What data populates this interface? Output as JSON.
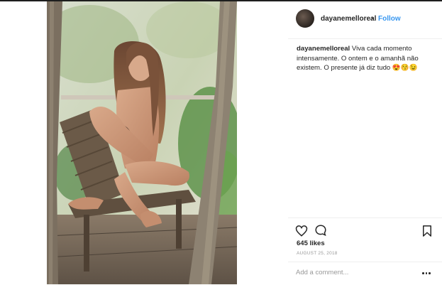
{
  "post": {
    "username": "dayanemelloreal",
    "separator": "•",
    "follow_label": "Follow",
    "caption_text": "Viva cada momento intensamente. O ontem e o amanhã não existem. O presente já diz tudo",
    "caption_emojis": "😍😚😉",
    "likes": "645 likes",
    "date": "AUGUST 25, 2018",
    "comment_placeholder": "Add a comment...",
    "photo": "woman-sitting-on-wooden-beach-chair"
  },
  "icons": {
    "like": "heart-icon",
    "comment": "speech-bubble-icon",
    "save": "bookmark-icon",
    "more": "more-options-icon",
    "avatar": "profile-avatar"
  },
  "colors": {
    "link": "#3897f0",
    "text": "#262626",
    "muted": "#999999",
    "divider": "#efefef"
  }
}
